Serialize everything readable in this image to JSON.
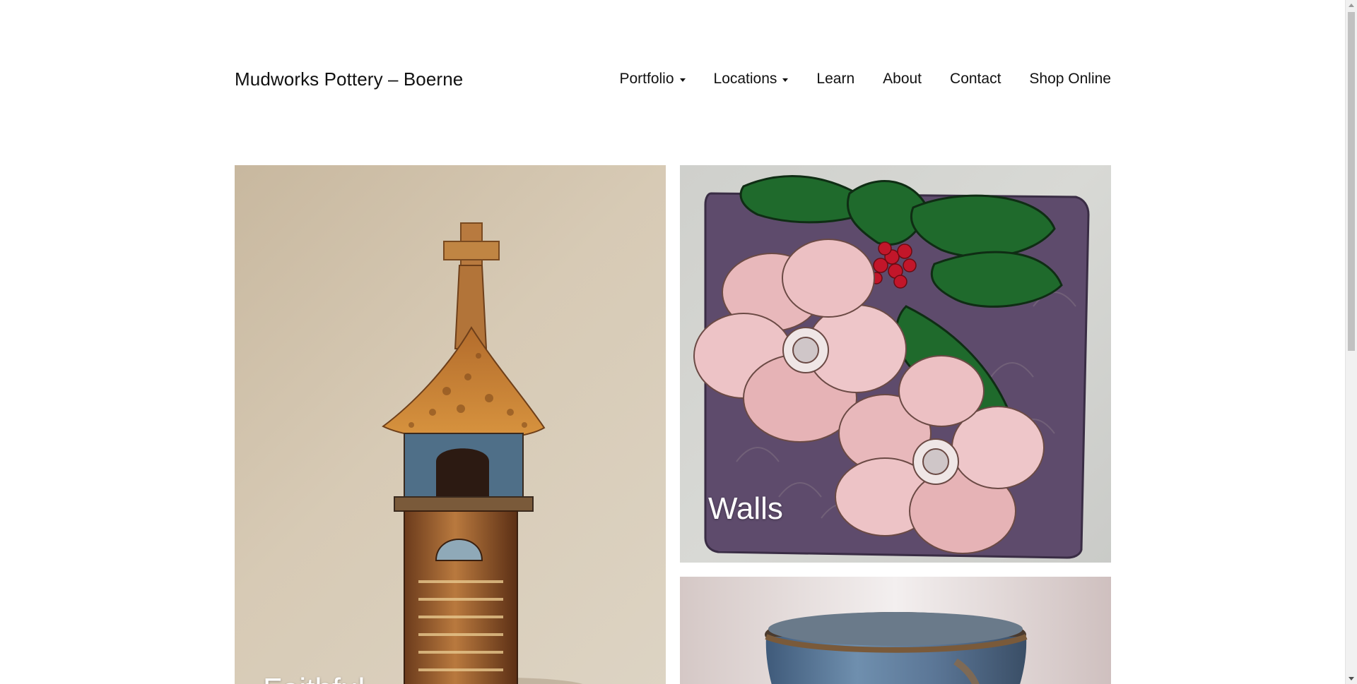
{
  "site": {
    "title": "Mudworks Pottery – Boerne"
  },
  "nav": {
    "items": [
      {
        "label": "Portfolio",
        "has_dropdown": true
      },
      {
        "label": "Locations",
        "has_dropdown": true
      },
      {
        "label": "Learn",
        "has_dropdown": false
      },
      {
        "label": "About",
        "has_dropdown": false
      },
      {
        "label": "Contact",
        "has_dropdown": false
      },
      {
        "label": "Shop Online",
        "has_dropdown": false
      }
    ]
  },
  "gallery": {
    "tiles": [
      {
        "caption": "Faithful",
        "image": "ceramic-bell-tower-sculpture"
      },
      {
        "caption": "Walls",
        "image": "ceramic-flower-wall-tile"
      },
      {
        "caption": "",
        "image": "blue-glazed-ceramic-pot"
      }
    ]
  },
  "colors": {
    "text": "#111111",
    "caption": "#ffffff",
    "background": "#ffffff"
  }
}
